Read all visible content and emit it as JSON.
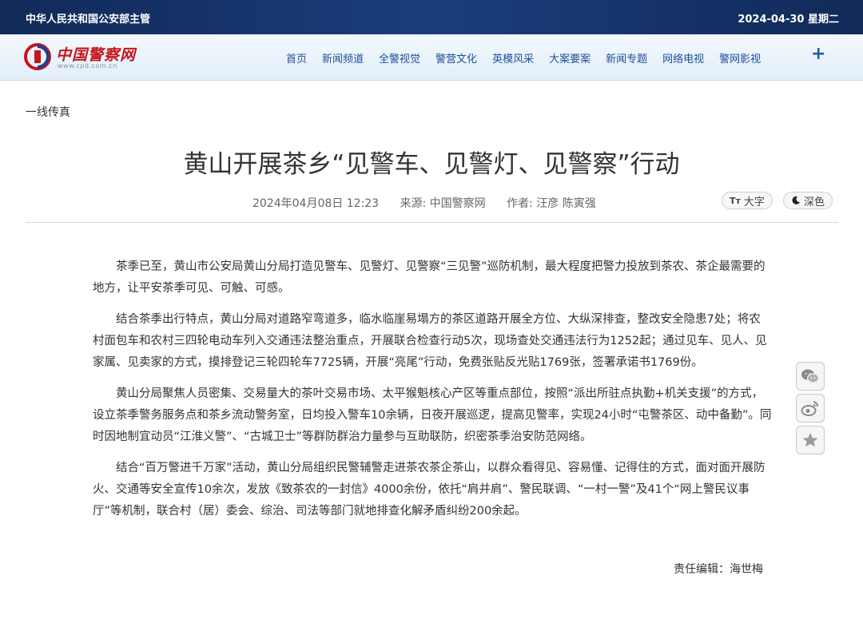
{
  "topbar": {
    "authority": "中华人民共和国公安部主管",
    "date": "2024-04-30 星期二"
  },
  "logo": {
    "name": "中国警察网",
    "url": "www.cpd.com.cn"
  },
  "nav": {
    "items": [
      "首页",
      "新闻频道",
      "全警视觉",
      "警营文化",
      "英模风采",
      "大案要案",
      "新闻专题",
      "网络电视",
      "警网影视"
    ],
    "more": "+"
  },
  "section": "一线传真",
  "article": {
    "title": "黄山开展茶乡“见警车、见警灯、见警察”行动",
    "datetime": "2024年04月08日 12:23",
    "source": "来源: 中国警察网",
    "author": "作者: 汪彦 陈寅强",
    "paragraphs": [
      "茶季已至，黄山市公安局黄山分局打造见警车、见警灯、见警察“三见警”巡防机制，最大程度把警力投放到茶农、茶企最需要的地方，让平安茶季可见、可触、可感。",
      "结合茶季出行特点，黄山分局对道路窄弯道多，临水临崖易塌方的茶区道路开展全方位、大纵深排查，整改安全隐患7处；将农村面包车和农村三四轮电动车列入交通违法整治重点，开展联合检查行动5次，现场查处交通违法行为1252起；通过见车、见人、见家属、见卖家的方式，摸排登记三轮四轮车7725辆，开展“亮尾”行动，免费张贴反光贴1769张，签署承诺书1769份。",
      "黄山分局聚焦人员密集、交易量大的茶叶交易市场、太平猴魁核心产区等重点部位，按照“派出所驻点执勤+机关支援”的方式，设立茶季警务服务点和茶乡流动警务室，日均投入警车10余辆，日夜开展巡逻，提高见警率，实现24小时“屯警茶区、动中备勤”。同时因地制宜动员“江淮义警”、“古城卫士”等群防群治力量参与互助联防，织密茶季治安防范网络。",
      "结合“百万警进千万家”活动，黄山分局组织民警辅警走进茶农茶企茶山，以群众看得见、容易懂、记得住的方式，面对面开展防火、交通等安全宣传10余次，发放《致茶农的一封信》4000余份，依托“肩并肩”、警民联调、“一村一警”及41个“网上警民议事厅”等机制，联合村（居）委会、综治、司法等部门就地排查化解矛盾纠纷200余起。"
    ],
    "editor": "责任编辑：海世梅"
  },
  "tools": {
    "font_icon": "Tт",
    "font_label": "大字",
    "dark_icon": "moon-icon",
    "dark_label": "深色"
  },
  "share": {
    "icons": [
      "wechat-icon",
      "weibo-icon",
      "star-icon"
    ]
  },
  "colors": {
    "topbar": "#112a58",
    "nav_text": "#1d4f99",
    "brand_red": "#c4161c"
  }
}
